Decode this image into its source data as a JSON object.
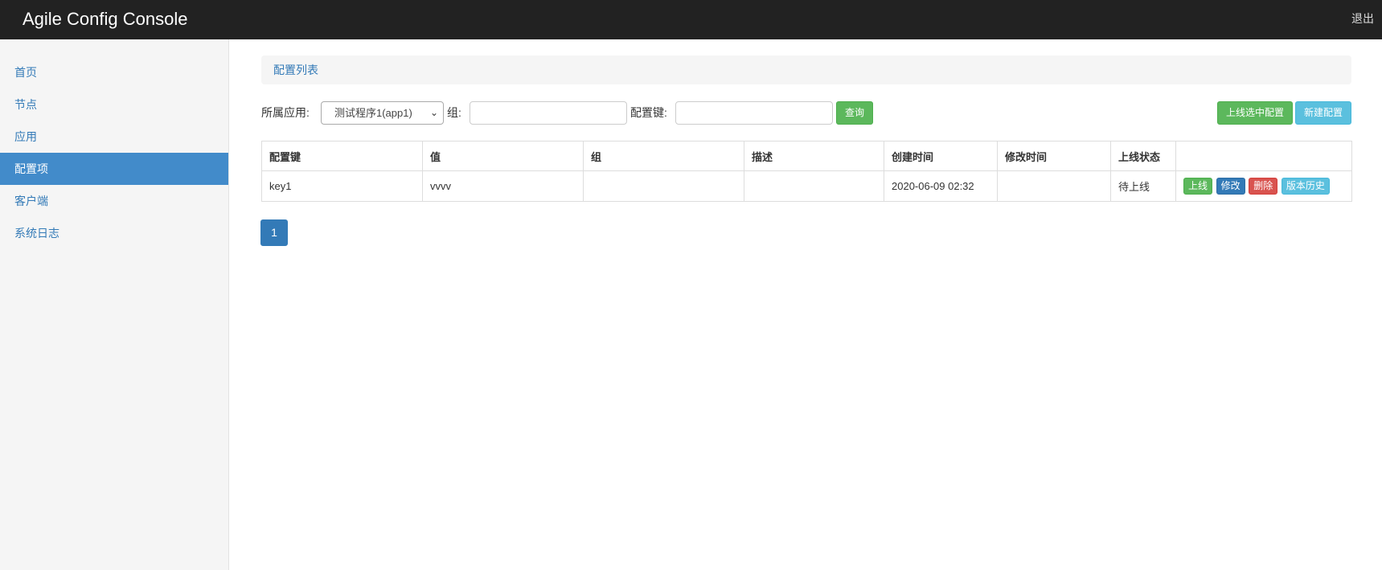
{
  "app": {
    "title": "Agile Config Console",
    "logout_label": "退出"
  },
  "sidebar": {
    "items": [
      {
        "label": "首页",
        "active": false
      },
      {
        "label": "节点",
        "active": false
      },
      {
        "label": "应用",
        "active": false
      },
      {
        "label": "配置项",
        "active": true
      },
      {
        "label": "客户端",
        "active": false
      },
      {
        "label": "系统日志",
        "active": false
      }
    ]
  },
  "breadcrumb": {
    "label": "配置列表"
  },
  "filters": {
    "app_label": "所属应用:",
    "app_selected": "测试程序1(app1)",
    "group_label": "组:",
    "group_value": "",
    "key_label": "配置键:",
    "key_value": "",
    "query_label": "查询"
  },
  "toolbar": {
    "publish_selected_label": "上线选中配置",
    "new_config_label": "新建配置"
  },
  "table": {
    "headers": [
      "配置键",
      "值",
      "组",
      "描述",
      "创建时间",
      "修改时间",
      "上线状态",
      ""
    ],
    "rows": [
      {
        "key": "key1",
        "value": "vvvv",
        "group": "",
        "description": "",
        "created": "2020-06-09 02:32",
        "modified": "",
        "status": "待上线",
        "actions": {
          "publish": "上线",
          "edit": "修改",
          "delete": "删除",
          "history": "版本历史"
        }
      }
    ]
  },
  "pagination": {
    "pages": [
      "1"
    ],
    "current": "1"
  },
  "colors": {
    "navbar": "#222222",
    "sidebar_active": "#428bca",
    "link": "#337ab7",
    "success": "#5cb85c",
    "info": "#5bc0de",
    "danger": "#d9534f",
    "warning_text": "#8a6d3b"
  }
}
